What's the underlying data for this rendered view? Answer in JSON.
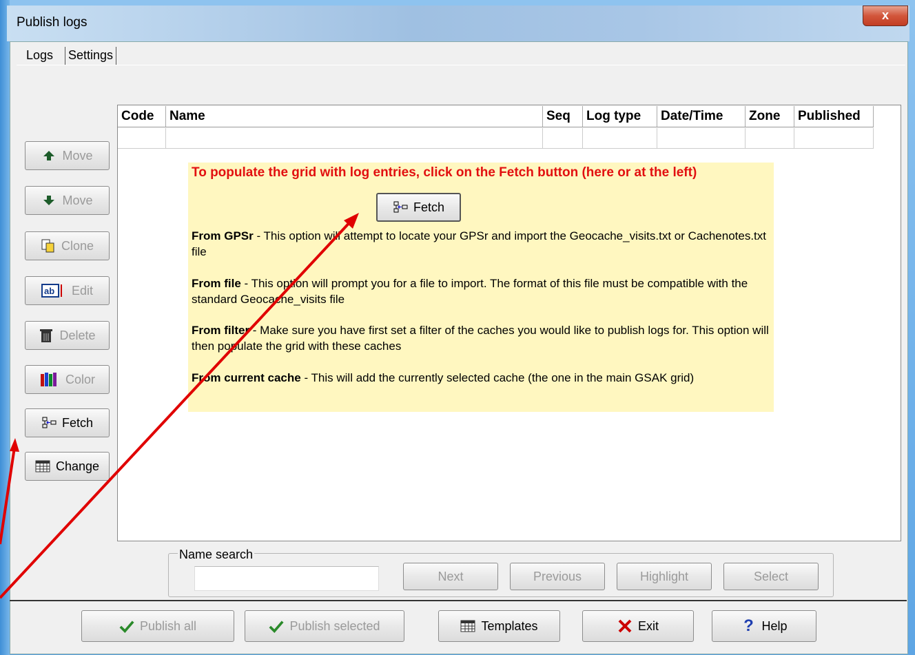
{
  "window": {
    "title": "Publish logs",
    "close_glyph": "x"
  },
  "tabs": [
    {
      "label": "Logs"
    },
    {
      "label": "Settings"
    }
  ],
  "grid": {
    "columns": [
      "Code",
      "Name",
      "Seq",
      "Log type",
      "Date/Time",
      "Zone",
      "Published"
    ]
  },
  "side_buttons": {
    "move_up": "Move",
    "move_down": "Move",
    "clone": "Clone",
    "edit": "Edit",
    "delete": "Delete",
    "color": "Color",
    "fetch": "Fetch",
    "change": "Change"
  },
  "info": {
    "heading": "To populate the grid with log entries, click on the Fetch button (here or at the left)",
    "fetch_label": "Fetch",
    "items": [
      {
        "title": "From GPSr",
        "text": " - This option will attempt to locate your GPSr and import the Geocache_visits.txt or Cachenotes.txt file"
      },
      {
        "title": "From file",
        "text": " - This option will prompt you for a file to import. The format of this file must be compatible with the standard Geocache_visits file"
      },
      {
        "title": "From filter",
        "text": " - Make sure you have first set a filter of the caches you would like to publish logs for. This option will then populate the grid with these caches"
      },
      {
        "title": "From current cache",
        "text": " - This will add the currently selected cache (the one in the main GSAK grid)"
      }
    ]
  },
  "name_search": {
    "label": "Name search",
    "value": "",
    "next": "Next",
    "previous": "Previous",
    "highlight": "Highlight",
    "select": "Select"
  },
  "bottom_buttons": {
    "publish_all": "Publish all",
    "publish_selected": "Publish selected",
    "templates": "Templates",
    "exit": "Exit",
    "help": "Help"
  },
  "colors": {
    "heading_red": "#e21010",
    "info_bg": "#fff7c0",
    "arrow_red": "#e00000"
  }
}
